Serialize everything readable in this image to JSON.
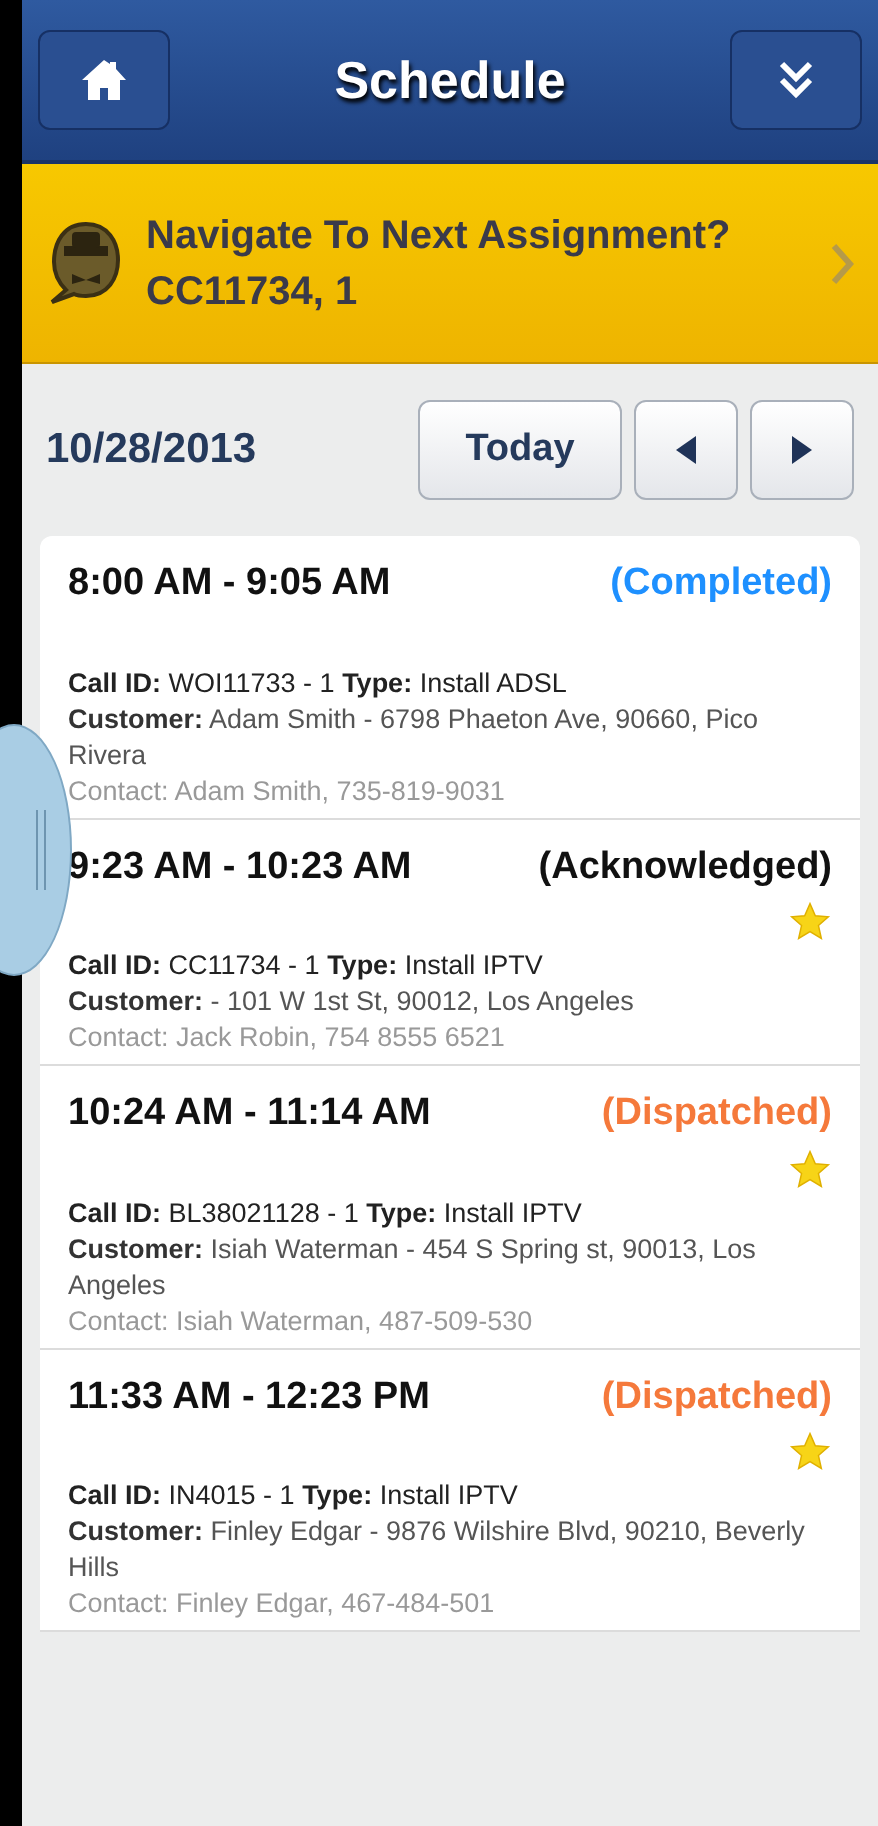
{
  "header": {
    "title": "Schedule"
  },
  "banner": {
    "title": "Navigate To Next Assignment?",
    "subtitle": "CC11734, 1"
  },
  "date_bar": {
    "date": "10/28/2013",
    "today_button": "Today"
  },
  "assignments": [
    {
      "time": "8:00 AM - 9:05 AM",
      "status": "(Completed)",
      "color": "#1e90ff",
      "starred": false,
      "call": "**Call ID:** WOI11733 - 1  **Type:** Install ADSL",
      "customer": "**Customer:**  Adam Smith - 6798 Phaeton Ave, 90660, Pico Rivera",
      "contact": "Contact:  Adam Smith, 735-819-9031"
    },
    {
      "time": "9:23 AM - 10:23 AM",
      "status": "(Acknowledged)",
      "color": "#111111",
      "starred": true,
      "call": "**Call ID:** CC11734 - 1  **Type:** Install IPTV",
      "customer": "**Customer:**   - 101 W 1st St, 90012, Los Angeles",
      "contact": "Contact:  Jack Robin, 754 8555 6521"
    },
    {
      "time": "10:24 AM - 11:14 AM",
      "status": "(Dispatched)",
      "color": "#f5793b",
      "starred": true,
      "call": "**Call ID:** BL38021128 - 1  **Type:** Install IPTV",
      "customer": "**Customer:**  Isiah Waterman - 454 S Spring st, 90013, Los Angeles",
      "contact": "Contact:  Isiah Waterman, 487-509-530"
    },
    {
      "time": "11:33 AM - 12:23 PM",
      "status": "(Dispatched)",
      "color": "#f5793b",
      "starred": true,
      "call": "**Call ID:** IN4015 - 1  **Type:** Install IPTV",
      "customer": "**Customer:**  Finley Edgar - 9876 Wilshire Blvd, 90210, Beverly Hills",
      "contact": "Contact:  Finley Edgar, 467-484-501"
    }
  ]
}
